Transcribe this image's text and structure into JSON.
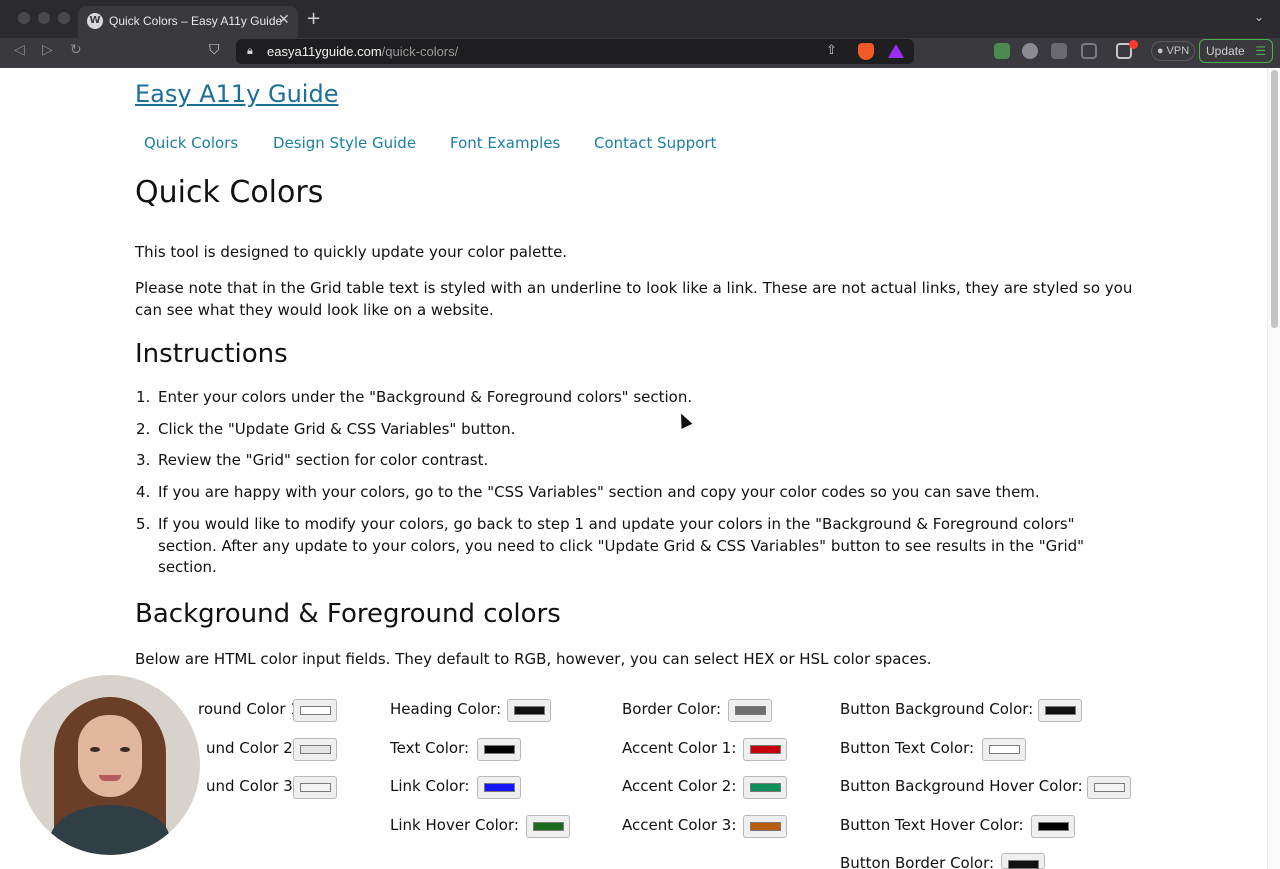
{
  "browser": {
    "tab_title": "Quick Colors – Easy A11y Guide",
    "url_host": "easya11yguide.com",
    "url_path": "/quick-colors/",
    "vpn_label": "VPN",
    "update_label": "Update",
    "favicon_letter": "W"
  },
  "site": {
    "title": "Easy A11y Guide",
    "nav": [
      "Quick Colors",
      "Design Style Guide",
      "Font Examples",
      "Contact Support"
    ]
  },
  "page": {
    "heading": "Quick Colors",
    "intro_1": "This tool is designed to quickly update your color palette.",
    "intro_2": "Please note that in the Grid table text is styled with an underline to look like a link. These are not actual links, they are styled so you can see what they would look like on a website.",
    "instructions_heading": "Instructions",
    "steps": [
      "Enter your colors under the \"Background & Foreground colors\" section.",
      "Click the \"Update Grid & CSS Variables\" button.",
      "Review the \"Grid\" section for color contrast.",
      "If you are happy with your colors, go to the \"CSS Variables\" section and copy your color codes so you can save them.",
      "If you would like to modify your colors, go back to step 1 and update your colors in the \"Background & Foreground colors\" section. After any update to your colors, you need to click \"Update Grid & CSS Variables\" button to see results in the \"Grid\" section."
    ],
    "step_numbers": [
      "1.",
      "2.",
      "3.",
      "4.",
      "5."
    ],
    "colors_heading": "Background & Foreground colors",
    "colors_intro": "Below are HTML color input fields. They default to RGB, however, you can select HEX or HSL color spaces."
  },
  "color_fields": {
    "col1": [
      {
        "label": "round Color 1:",
        "color": "#ffffff"
      },
      {
        "label": "und Color 2:",
        "color": "#e4e4e4"
      },
      {
        "label": "und Color 3:",
        "color": "#f4f4f4"
      }
    ],
    "col2": [
      {
        "label": "Heading Color:",
        "color": "#111111"
      },
      {
        "label": "Text Color:",
        "color": "#000000"
      },
      {
        "label": "Link Color:",
        "color": "#1414ff"
      },
      {
        "label": "Link Hover Color:",
        "color": "#1b6b1e"
      }
    ],
    "col3": [
      {
        "label": "Border Color:",
        "color": "#6e6e6e"
      },
      {
        "label": "Accent Color 1:",
        "color": "#c4000a"
      },
      {
        "label": "Accent Color 2:",
        "color": "#0d8f5a"
      },
      {
        "label": "Accent Color 3:",
        "color": "#b85c10"
      }
    ],
    "col4": [
      {
        "label": "Button Background Color:",
        "color": "#111111"
      },
      {
        "label": "Button Text Color:",
        "color": "#ffffff"
      },
      {
        "label": "Button Background Hover Color:",
        "color": "#f4f4f4"
      },
      {
        "label": "Button Text Hover Color:",
        "color": "#000000"
      },
      {
        "label": "Button Border Color:",
        "color": "#111111"
      }
    ]
  }
}
